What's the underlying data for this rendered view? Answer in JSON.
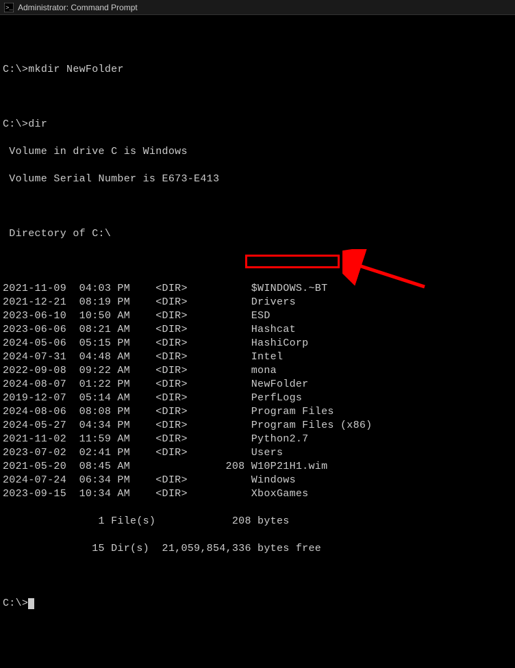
{
  "titlebar": {
    "title": "Administrator: Command Prompt"
  },
  "terminal": {
    "prompt1": "C:\\>",
    "cmd1": "mkdir NewFolder",
    "prompt2": "C:\\>",
    "cmd2": "dir",
    "volLine": " Volume in drive C is Windows",
    "serialLine": " Volume Serial Number is E673-E413",
    "dirOfLine": " Directory of C:\\",
    "entries": [
      {
        "date": "2021-11-09",
        "time": "04:03 PM",
        "type": "<DIR>",
        "size": "         ",
        "name": "$WINDOWS.~BT"
      },
      {
        "date": "2021-12-21",
        "time": "08:19 PM",
        "type": "<DIR>",
        "size": "         ",
        "name": "Drivers"
      },
      {
        "date": "2023-06-10",
        "time": "10:50 AM",
        "type": "<DIR>",
        "size": "         ",
        "name": "ESD"
      },
      {
        "date": "2023-06-06",
        "time": "08:21 AM",
        "type": "<DIR>",
        "size": "         ",
        "name": "Hashcat"
      },
      {
        "date": "2024-05-06",
        "time": "05:15 PM",
        "type": "<DIR>",
        "size": "         ",
        "name": "HashiCorp"
      },
      {
        "date": "2024-07-31",
        "time": "04:48 AM",
        "type": "<DIR>",
        "size": "         ",
        "name": "Intel"
      },
      {
        "date": "2022-09-08",
        "time": "09:22 AM",
        "type": "<DIR>",
        "size": "         ",
        "name": "mona"
      },
      {
        "date": "2024-08-07",
        "time": "01:22 PM",
        "type": "<DIR>",
        "size": "         ",
        "name": "NewFolder"
      },
      {
        "date": "2019-12-07",
        "time": "05:14 AM",
        "type": "<DIR>",
        "size": "         ",
        "name": "PerfLogs"
      },
      {
        "date": "2024-08-06",
        "time": "08:08 PM",
        "type": "<DIR>",
        "size": "         ",
        "name": "Program Files"
      },
      {
        "date": "2024-05-27",
        "time": "04:34 PM",
        "type": "<DIR>",
        "size": "         ",
        "name": "Program Files (x86)"
      },
      {
        "date": "2021-11-02",
        "time": "11:59 AM",
        "type": "<DIR>",
        "size": "         ",
        "name": "Python2.7"
      },
      {
        "date": "2023-07-02",
        "time": "02:41 PM",
        "type": "<DIR>",
        "size": "         ",
        "name": "Users"
      },
      {
        "date": "2021-05-20",
        "time": "08:45 AM",
        "type": "     ",
        "size": "      208",
        "name": "W10P21H1.wim"
      },
      {
        "date": "2024-07-24",
        "time": "06:34 PM",
        "type": "<DIR>",
        "size": "         ",
        "name": "Windows"
      },
      {
        "date": "2023-09-15",
        "time": "10:34 AM",
        "type": "<DIR>",
        "size": "         ",
        "name": "XboxGames"
      }
    ],
    "summary1": "               1 File(s)            208 bytes",
    "summary2": "              15 Dir(s)  21,059,854,336 bytes free",
    "prompt3": "C:\\>"
  },
  "annotation": {
    "highlightedEntry": "NewFolder"
  }
}
